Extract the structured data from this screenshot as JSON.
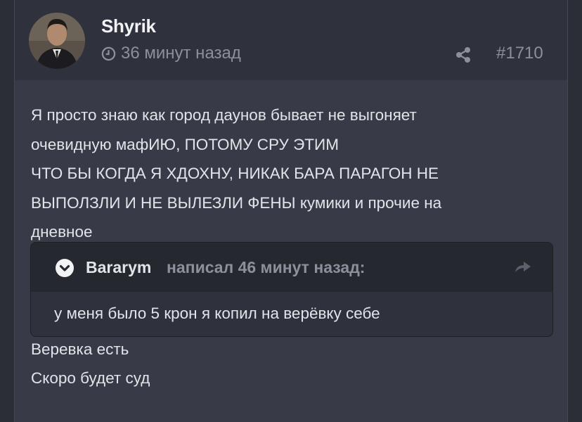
{
  "post": {
    "author": "Shyrik",
    "time": "36 минут назад",
    "number": "#1710",
    "lines": [
      "Я просто знаю как город даунов бывает не выгоняет",
      "очевидную мафИЮ, ПОТОМУ СРУ ЭТИМ",
      "ЧТО БЫ КОГДА Я ХДОХНУ, НИКАК БАРА ПАРАГОН НЕ",
      "ВЫПОЛЗЛИ И НЕ ВЫЛЕЗЛИ ФЕНЫ кумики и прочие на",
      "дневное"
    ],
    "quote": {
      "author": "Bararym",
      "meta": "написал 46 минут назад:",
      "text": "у меня было 5 крон я копил на верёвку себе"
    },
    "after_lines": [
      "Веревка есть",
      "Скоро будет суд"
    ],
    "icons": {
      "clock": "clock-icon",
      "share": "share-icon",
      "expand": "chevron-down-circle-icon",
      "reply": "reply-arrow-icon"
    }
  }
}
